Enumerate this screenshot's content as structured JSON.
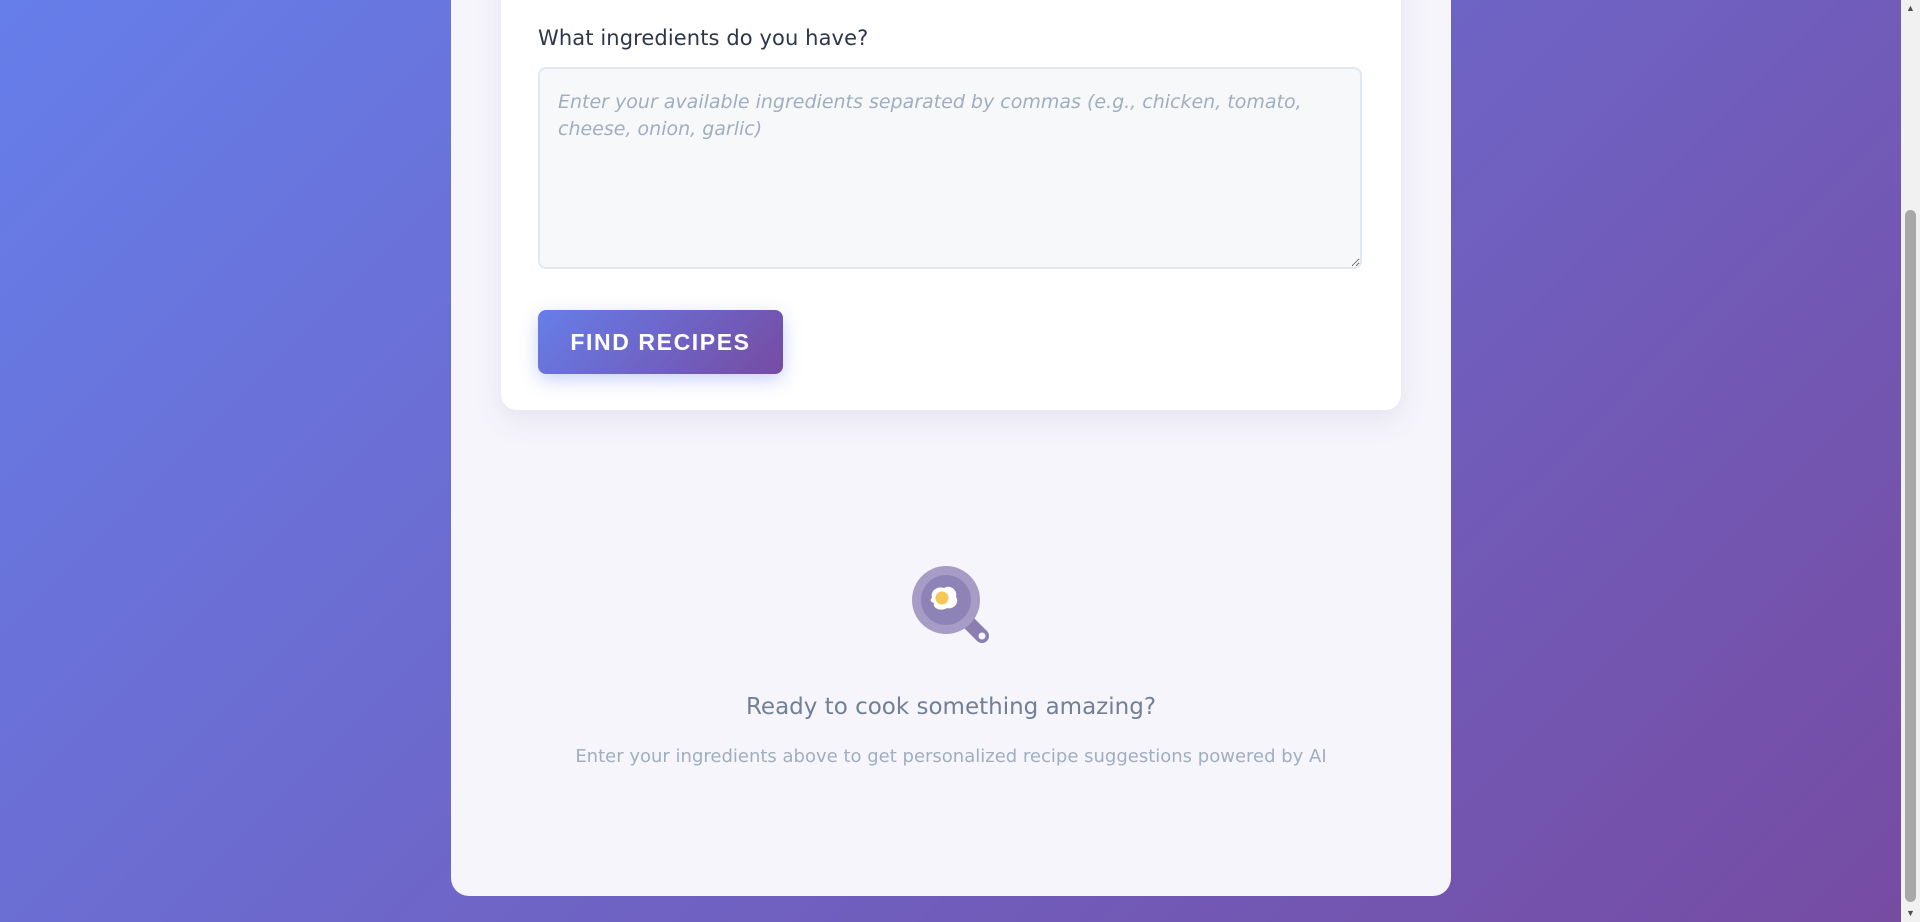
{
  "form": {
    "label": "What ingredients do you have?",
    "ingredients_value": "",
    "ingredients_placeholder": "Enter your available ingredients separated by commas (e.g., chicken, tomato, cheese, onion, garlic)",
    "submit_label": "FIND RECIPES"
  },
  "empty_state": {
    "icon": "frying-pan-egg-icon",
    "title": "Ready to cook something amazing?",
    "subtitle": "Enter your ingredients above to get personalized recipe suggestions powered by AI"
  },
  "colors": {
    "gradient_start": "#667eea",
    "gradient_end": "#764ba2",
    "text_dark": "#2d3748",
    "text_muted": "#718096"
  }
}
